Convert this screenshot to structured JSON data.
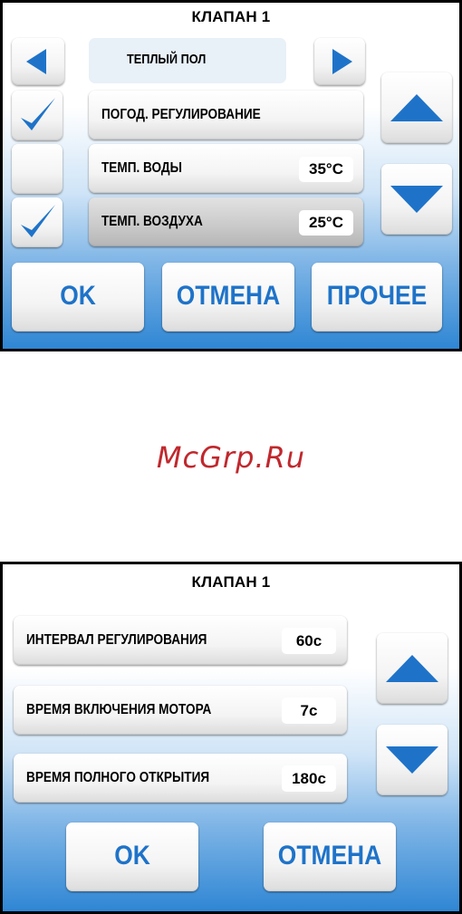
{
  "screen1": {
    "title": "КЛАПАН 1",
    "mode_label": "ТЕПЛЫЙ ПОЛ",
    "rows": [
      {
        "label": "ПОГОД. РЕГУЛИРОВАНИЕ",
        "value": null,
        "checked": true
      },
      {
        "label": "ТЕМП. ВОДЫ",
        "value": "35°C",
        "checked": false
      },
      {
        "label": "ТЕМП. ВОЗДУХА",
        "value": "25°C",
        "checked": true,
        "selected": true
      }
    ],
    "buttons": {
      "ok": "OK",
      "cancel": "ОТМЕНА",
      "other": "ПРОЧЕЕ"
    }
  },
  "watermark": "McGrp.Ru",
  "screen2": {
    "title": "КЛАПАН 1",
    "rows": [
      {
        "label": "ИНТЕРВАЛ РЕГУЛИРОВАНИЯ",
        "value": "60c"
      },
      {
        "label": "ВРЕМЯ ВКЛЮЧЕНИЯ МОТОРА",
        "value": "7c"
      },
      {
        "label": "ВРЕМЯ ПОЛНОГО ОТКРЫТИЯ",
        "value": "180c"
      }
    ],
    "buttons": {
      "ok": "OK",
      "cancel": "ОТМЕНА"
    }
  },
  "colors": {
    "accent": "#1e73c9",
    "watermark": "#c0282d"
  },
  "icons": [
    "arrow-left-icon",
    "arrow-right-icon",
    "arrow-up-icon",
    "arrow-down-icon",
    "checkmark-icon"
  ]
}
